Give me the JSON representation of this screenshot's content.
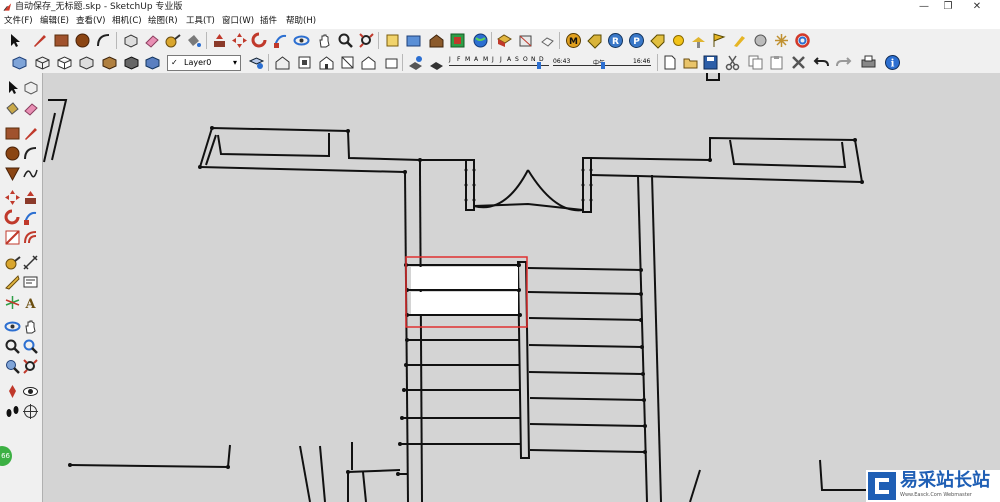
{
  "window": {
    "title": "自动保存_无标题.skp - SketchUp 专业版",
    "controls": {
      "minimize": "—",
      "maximize": "❐",
      "close": "✕"
    }
  },
  "menu": [
    "文件(F)",
    "编辑(E)",
    "查看(V)",
    "相机(C)",
    "绘图(R)",
    "工具(T)",
    "窗口(W)",
    "插件",
    "帮助(H)"
  ],
  "layers": {
    "check": "✓",
    "current": "Layer0",
    "arrow": "▾"
  },
  "shadow_timeline": {
    "months": [
      "J",
      "F",
      "M",
      "A",
      "M",
      "J",
      "J",
      "A",
      "S",
      "O",
      "N",
      "D"
    ],
    "time_start": "06:43",
    "time_mid": "中午",
    "time_end": "16:46"
  },
  "status": {
    "badge": "66"
  },
  "watermark": {
    "text": "易采站长站",
    "subtext": "Www.Easck.Com Webmaster"
  },
  "colors": {
    "selection_box": "#e03030",
    "viewport_bg": "#d4d4d4",
    "toolbar_bg": "#f0f0f0"
  }
}
